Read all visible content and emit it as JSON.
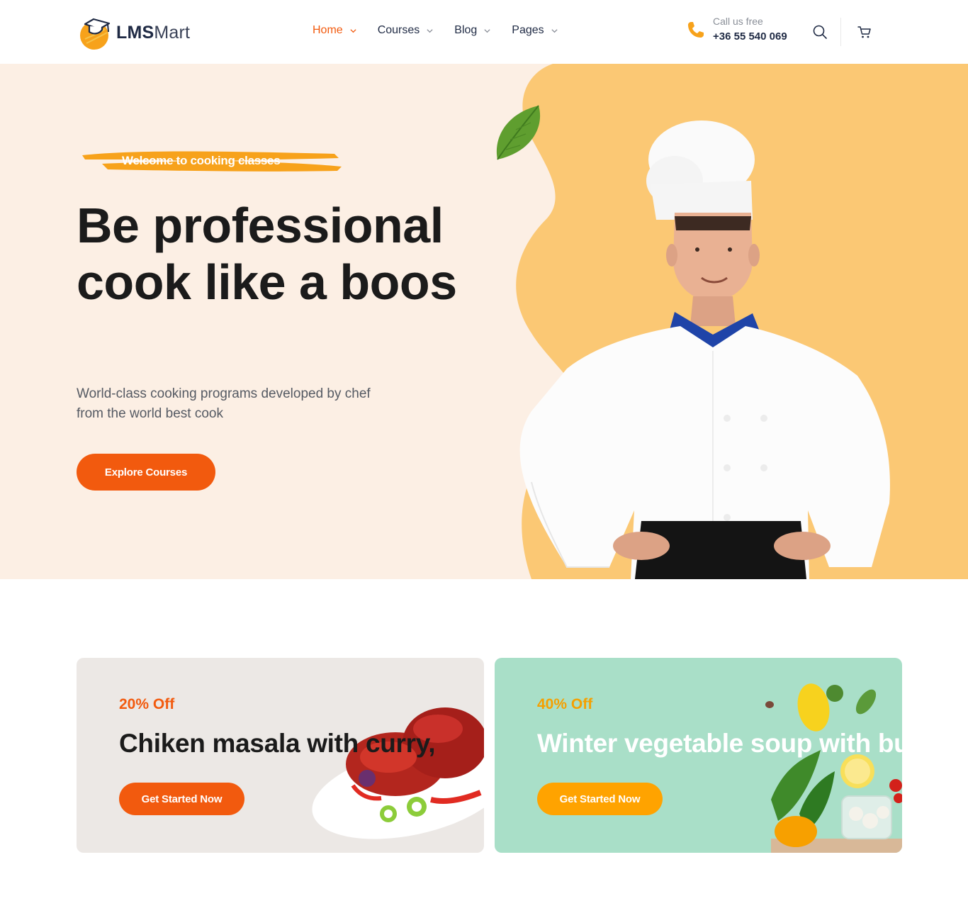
{
  "brand": {
    "name_bold": "LMS",
    "name_regular": "Mart",
    "accent": "#f25a0e",
    "logo_icon": "graduation-cap-icon"
  },
  "nav": {
    "items": [
      {
        "label": "Home",
        "active": true
      },
      {
        "label": "Courses",
        "active": false
      },
      {
        "label": "Blog",
        "active": false
      },
      {
        "label": "Pages",
        "active": false
      }
    ]
  },
  "contact": {
    "label": "Call us free",
    "phone": "+36 55 540 069",
    "icon": "phone-icon"
  },
  "header_actions": {
    "search_icon": "search-icon",
    "cart_icon": "cart-icon"
  },
  "hero": {
    "eyebrow": "Welcome to cooking classes",
    "title": "Be professional cook like a boos",
    "description": "World-class cooking programs developed by chef from the world best cook",
    "cta_label": "Explore Courses",
    "background": "#fcefe4",
    "blob_color": "#fbc874"
  },
  "promos": [
    {
      "discount": "20% Off",
      "title": "Chiken masala with curry,",
      "cta_label": "Get Started Now",
      "background": "#ece8e5"
    },
    {
      "discount": "40% Off",
      "title": "Winter vegetable soup with bu",
      "cta_label": "Get Started Now",
      "background": "#a9dfc8"
    }
  ]
}
